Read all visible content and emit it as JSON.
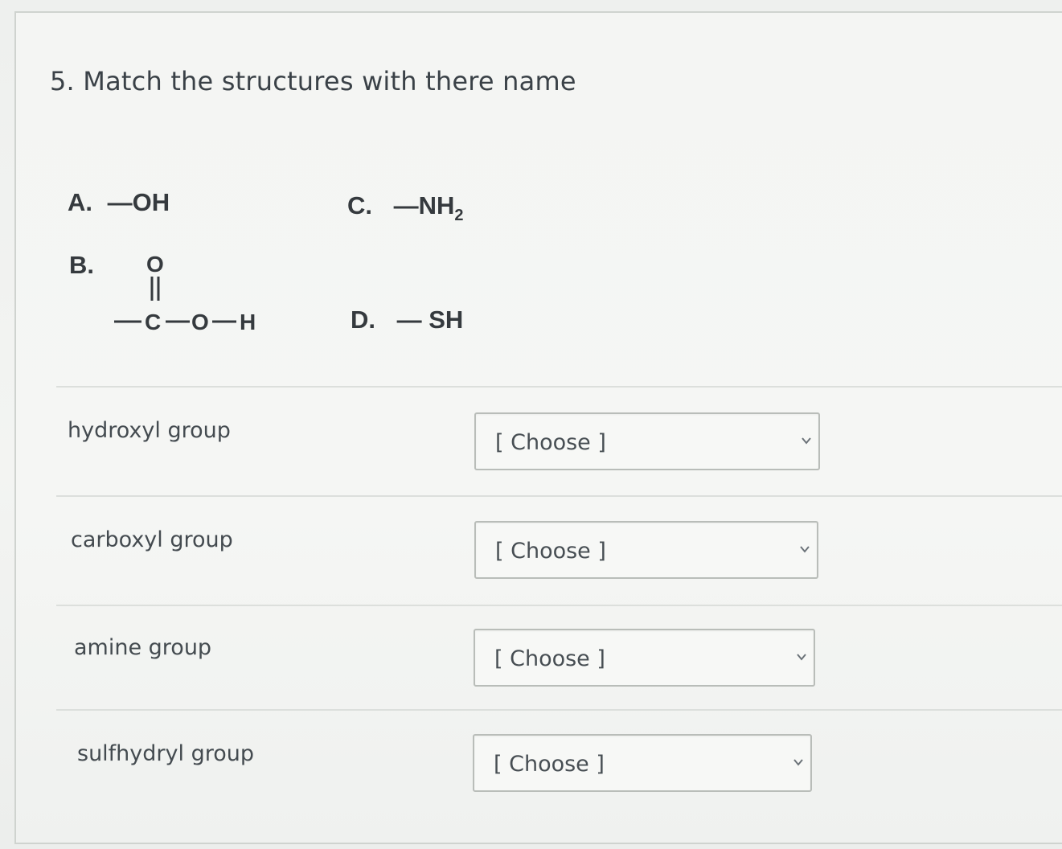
{
  "question": {
    "text": "5. Match the structures with there name"
  },
  "structures": {
    "a": {
      "letter": "A.",
      "formula": "—OH"
    },
    "b": {
      "letter": "B.",
      "atoms": [
        "O",
        "C",
        "O",
        "H"
      ]
    },
    "c": {
      "letter": "C.",
      "formula": "—NH",
      "subscript": "2"
    },
    "d": {
      "letter": "D.",
      "formula": "— SH"
    }
  },
  "matches": [
    {
      "label": "hydroxyl group",
      "selected": "[ Choose ]"
    },
    {
      "label": "carboxyl group",
      "selected": "[ Choose ]"
    },
    {
      "label": "amine group",
      "selected": "[ Choose ]"
    },
    {
      "label": "sulfhydryl group",
      "selected": "[ Choose ]"
    }
  ],
  "icons": {
    "dropdown": "chevron-down-icon"
  },
  "colors": {
    "text": "#3a4147",
    "border": "#b9bdb9",
    "background": "#f4f5f3"
  }
}
